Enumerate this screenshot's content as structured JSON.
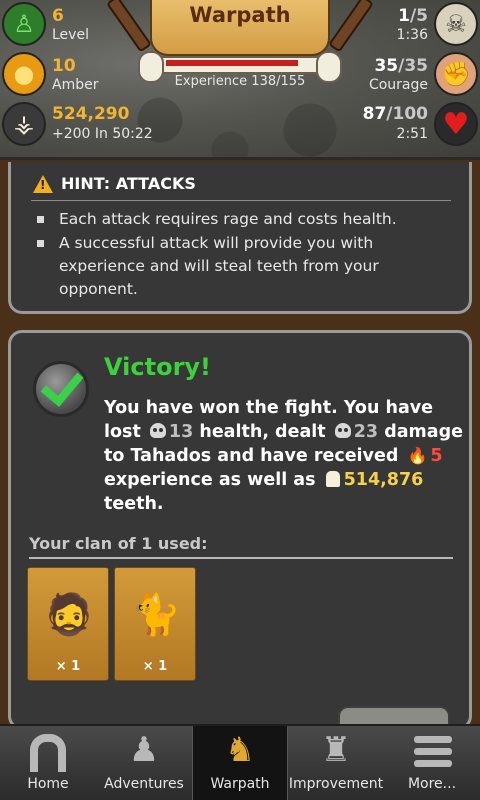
{
  "header": {
    "title": "Warpath",
    "experience_text": "Experience 138/155",
    "experience_fraction": 0.89,
    "level": {
      "value": "6",
      "label": "Level"
    },
    "amber": {
      "value": "10",
      "label": "Amber"
    },
    "teeth": {
      "value": "524,290",
      "sub": "+200  In 50:22"
    },
    "rage": {
      "current": "1",
      "max": "/5",
      "timer": "1:36"
    },
    "courage": {
      "current": "35",
      "max": "/35",
      "label": "Courage"
    },
    "health": {
      "current": "87",
      "max": "/100",
      "timer": "2:51"
    }
  },
  "hint": {
    "title": "HINT: ATTACKS",
    "items": [
      "Each attack requires rage and costs health.",
      "A successful attack will provide you with experience and will steal teeth from your opponent."
    ]
  },
  "result": {
    "title": "Victory!",
    "text_1": "You have won the fight. You have lost",
    "lost_health": "13",
    "text_2": "health, dealt",
    "dealt_damage": "23",
    "text_3": "damage to Tahados and have received",
    "xp_gained": "5",
    "text_4": "experience as well as",
    "teeth_gained": "514,876",
    "text_5": "teeth."
  },
  "clan": {
    "label": "Your clan of 1 used:",
    "members": [
      {
        "name": "caveman",
        "count": "× 1"
      },
      {
        "name": "lynx",
        "count": "× 1"
      }
    ]
  },
  "nav": {
    "items": [
      {
        "label": "Home"
      },
      {
        "label": "Adventures"
      },
      {
        "label": "Warpath"
      },
      {
        "label": "Improvement"
      },
      {
        "label": "More..."
      }
    ],
    "active": "Warpath"
  },
  "colors": {
    "accent": "#f3b431",
    "victory": "#3dd23d",
    "panel": "#373737",
    "frame": "#9a9a9a"
  }
}
